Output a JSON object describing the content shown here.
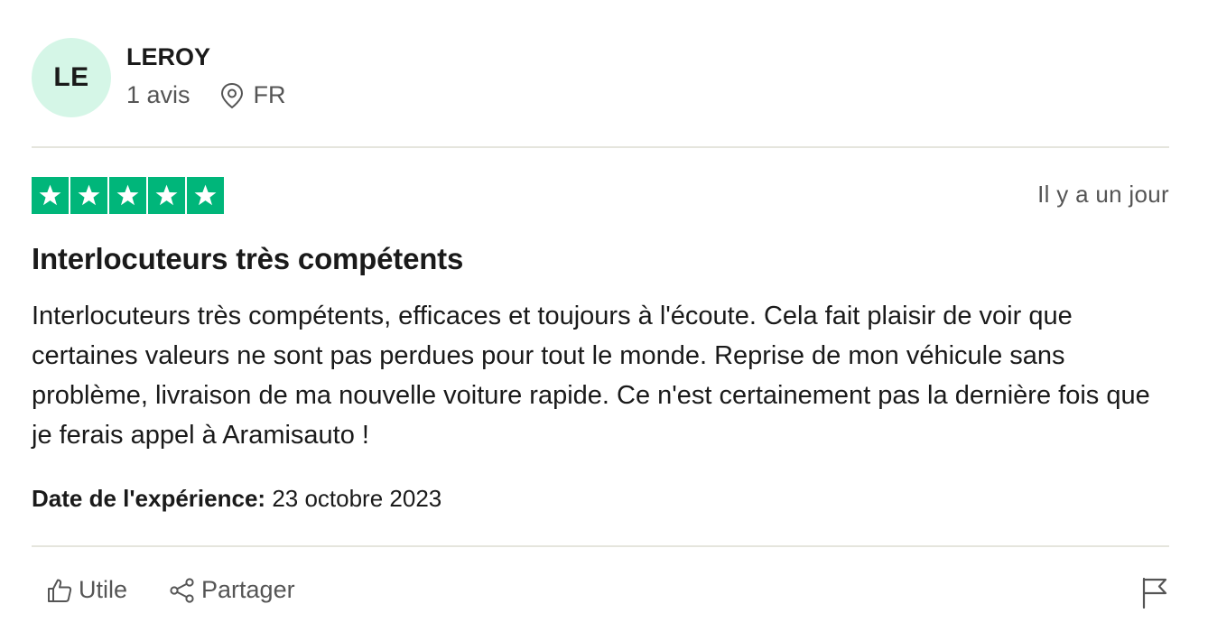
{
  "consumer": {
    "initials": "LE",
    "name": "LEROY",
    "review_count": "1 avis",
    "country": "FR",
    "avatar_color": "#d5f6e7"
  },
  "review": {
    "rating": 5,
    "rating_color": "#00b67a",
    "date": "Il y a un jour",
    "title": "Interlocuteurs très compétents",
    "body": "Interlocuteurs très compétents, efficaces et toujours à l'écoute. Cela fait plaisir de voir que certaines valeurs ne sont pas perdues pour tout le monde. Reprise de mon véhicule sans problème, livraison de ma nouvelle voiture rapide. Ce n'est certainement pas la dernière fois que je ferais appel à Aramisauto !",
    "experience_label": "Date de l'expérience:",
    "experience_date": "23 octobre 2023"
  },
  "actions": {
    "useful_label": "Utile",
    "share_label": "Partager",
    "useful_icon": "thumbs-up-icon",
    "share_icon": "share-icon",
    "report_icon": "flag-icon",
    "location_icon": "location-pin-icon",
    "star_icon": "star-icon"
  }
}
